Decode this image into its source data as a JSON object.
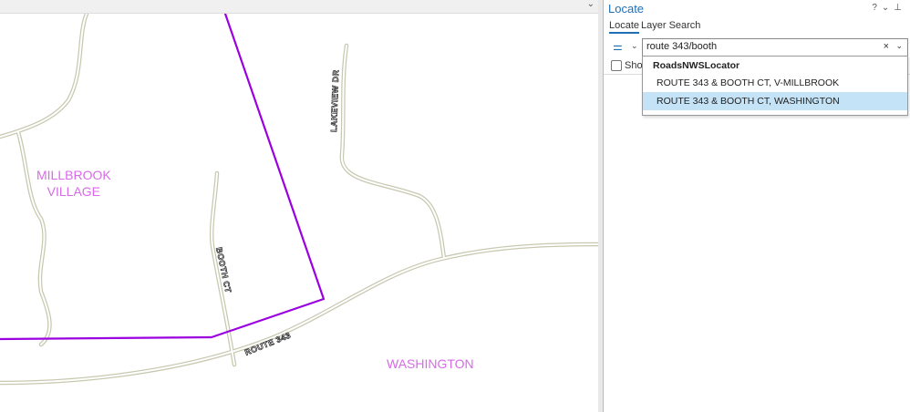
{
  "map": {
    "labels": {
      "millbrook_line1": "MILLBROOK",
      "millbrook_line2": "VILLAGE",
      "washington": "WASHINGTON"
    },
    "roads": {
      "lakeview": "LAKEVIEW DR",
      "booth": "BOOTH CT",
      "route": "ROUTE 343"
    },
    "colors": {
      "boundary": "#9b00e0",
      "road_casing": "#c8c8b0",
      "label": "#d66be6"
    }
  },
  "panel": {
    "title": "Locate",
    "tools": [
      "?",
      "⌄",
      "⊥"
    ],
    "tabs": [
      {
        "label": "Locate",
        "active": true
      },
      {
        "label": "Layer Search",
        "active": false
      }
    ],
    "search": {
      "value": "route 343/booth",
      "clear": "×",
      "dropdown": "⌄"
    },
    "options_icon": "⚌",
    "options_chevron": "⌄",
    "show_label": "Show",
    "suggestions": {
      "header": "RoadsNWSLocator",
      "items": [
        {
          "label": "ROUTE 343 & BOOTH CT, V-MILLBROOK",
          "selected": false
        },
        {
          "label": "ROUTE 343 & BOOTH CT, WASHINGTON",
          "selected": true
        }
      ]
    }
  }
}
